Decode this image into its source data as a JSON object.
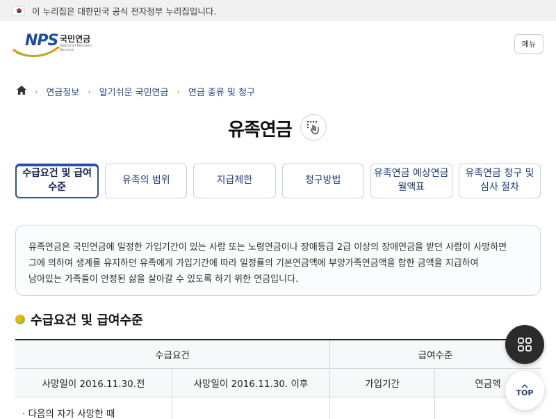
{
  "gov_banner": {
    "text": "이 누리집은 대한민국 공식 전자정부 누리집입니다."
  },
  "header": {
    "logo": {
      "brand": "NPS",
      "korean": "국민연금",
      "english": "National Pension Service"
    },
    "menu_label": "메뉴"
  },
  "breadcrumb": {
    "items": [
      "연금정보",
      "알기쉬운 국민연금",
      "연금 종류 및 청구"
    ]
  },
  "page": {
    "title": "유족연금"
  },
  "tabs": [
    {
      "label": "수급요건 및 급여수준",
      "active": true
    },
    {
      "label": "유족의 범위"
    },
    {
      "label": "지급제한"
    },
    {
      "label": "청구방법"
    },
    {
      "label": "유족연금 예상연금월액표"
    },
    {
      "label": "유족연금 청구 및 심사 절차"
    }
  ],
  "intro": {
    "line1": "유족연금은 국민연금에 일정한 가입기간이 있는 사람 또는 노령연금이나 장애등급 2급 이상의 장애연금을 받던 사람이 사망하면",
    "line2": "그에 의하여 생계를 유지하던 유족에게 가입기간에 따라 일정률의 기본연금액에 부양가족연금액을 합한 금액을 지급하여",
    "line3": "남아있는 가족들이 안정된 삶을 살아갈 수 있도록 하기 위한 연금입니다."
  },
  "section": {
    "title": "수급요건 및 급여수준"
  },
  "table": {
    "group_headers": [
      "수급요건",
      "급여수준"
    ],
    "sub_headers": [
      "사망일이 2016.11.30.전",
      "사망일이 2016.11.30. 이후",
      "가입기간",
      "연금액"
    ],
    "first_row_text": "· 다음의 자가 사망한 때"
  },
  "floating": {
    "top_label": "TOP"
  },
  "colors": {
    "primary": "#2d4da8",
    "brand": "#1b4ea3",
    "fab_dark": "#2b2b2b"
  }
}
